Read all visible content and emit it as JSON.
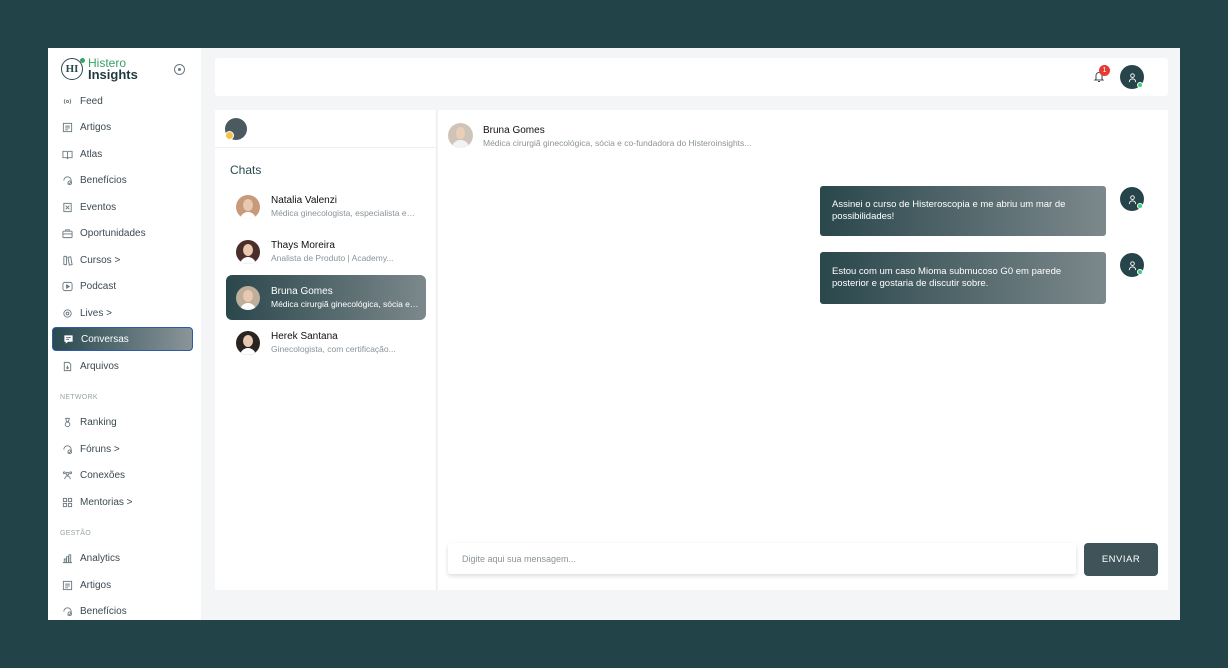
{
  "brand": {
    "line1": "Histero",
    "line2": "Insights",
    "mark": "HI"
  },
  "sidebar": {
    "items": [
      {
        "label": "Feed",
        "icon": "broadcast-icon"
      },
      {
        "label": "Artigos",
        "icon": "document-icon"
      },
      {
        "label": "Atlas",
        "icon": "book-icon"
      },
      {
        "label": "Benefícios",
        "icon": "gift-icon"
      },
      {
        "label": "Eventos",
        "icon": "calendar-icon"
      },
      {
        "label": "Oportunidades",
        "icon": "briefcase-icon"
      },
      {
        "label": "Cursos >",
        "icon": "library-icon"
      },
      {
        "label": "Podcast",
        "icon": "play-icon"
      },
      {
        "label": "Lives >",
        "icon": "live-icon"
      },
      {
        "label": "Conversas",
        "icon": "chat-icon",
        "active": true
      },
      {
        "label": "Arquivos",
        "icon": "file-icon"
      }
    ],
    "network_label": "NETWORK",
    "network_items": [
      {
        "label": "Ranking",
        "icon": "medal-icon"
      },
      {
        "label": "Fóruns >",
        "icon": "forum-icon"
      },
      {
        "label": "Conexões",
        "icon": "users-icon"
      },
      {
        "label": "Mentorias >",
        "icon": "grid-icon"
      }
    ],
    "gestao_label": "GESTÃO",
    "gestao_items": [
      {
        "label": "Analytics",
        "icon": "bar-chart-icon"
      },
      {
        "label": "Artigos",
        "icon": "document-icon"
      },
      {
        "label": "Benefícios",
        "icon": "gift-icon"
      }
    ]
  },
  "topbar": {
    "notification_count": "1"
  },
  "chats": {
    "title": "Chats",
    "items": [
      {
        "name": "Natalia Valenzi",
        "subtitle": "Médica ginecologista, especialista em..."
      },
      {
        "name": "Thays Moreira",
        "subtitle": "Analista de Produto | Academy..."
      },
      {
        "name": "Bruna Gomes",
        "subtitle": "Médica cirurgiã ginecológica, sócia e co-fundadora",
        "active": true
      },
      {
        "name": "Herek Santana",
        "subtitle": "Ginecologista, com certificação..."
      }
    ]
  },
  "conversation": {
    "name": "Bruna Gomes",
    "subtitle": "Médica cirurgiã ginecológica, sócia e co-fundadora do Histeroinsights...",
    "messages": [
      {
        "text": "Assinei o curso de Histeroscopia e me abriu um mar de possibilidades!"
      },
      {
        "text": "Estou com um caso Mioma submucoso G0 em parede posterior e gostaria de discutir sobre."
      }
    ],
    "input_placeholder": "Digite aqui sua mensagem...",
    "send_label": "ENVIAR"
  },
  "colors": {
    "background": "#224348",
    "accent": "#2a474c",
    "brand_green": "#3aa06a",
    "badge_red": "#e53935",
    "online": "#3ccf7a"
  }
}
